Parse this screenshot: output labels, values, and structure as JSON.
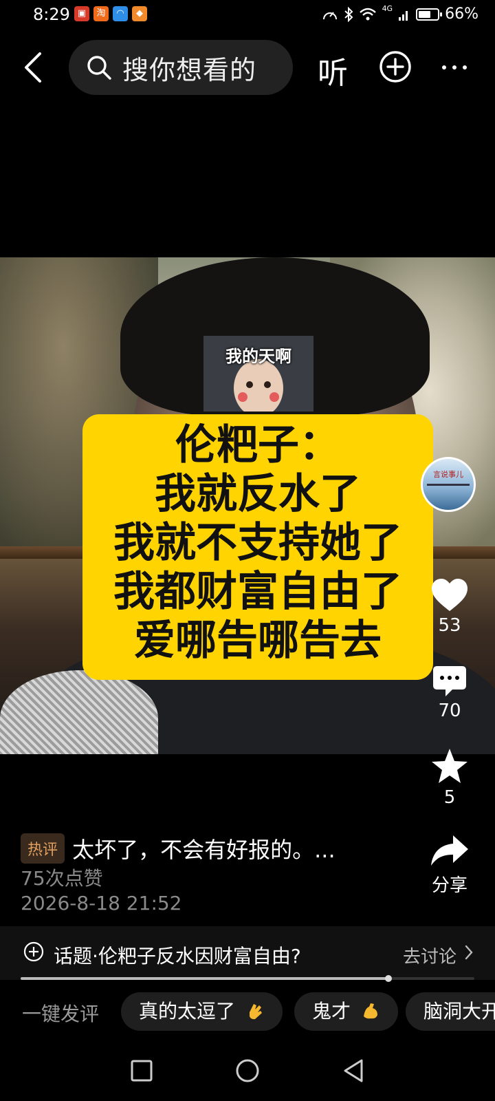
{
  "status_bar": {
    "time": "8:29",
    "network": "4G",
    "battery": "66%",
    "battery_level": 0.66,
    "notification_icons": [
      "app-icon-red",
      "taobao-icon",
      "app-icon-blue",
      "app-icon-orange"
    ]
  },
  "top_bar": {
    "search_placeholder": "搜你想看的",
    "listen_label": "听",
    "icons": [
      "back-arrow-icon",
      "search-icon",
      "plus-circle-icon",
      "more-dots-icon"
    ]
  },
  "video": {
    "sticker_text": "我的天啊",
    "caption_lines": [
      "伦粑子：",
      "我就反水了",
      "我就不支持她了",
      "我都财富自由了",
      "爱哪告哪告去"
    ],
    "author_avatar_text": "言说事儿",
    "caption_color": "#ffd400"
  },
  "actions": {
    "likes": "53",
    "comments": "70",
    "favorites": "5",
    "share_label": "分享"
  },
  "hot_comment": {
    "tag": "热评",
    "text": "太坏了，不会有好报的。...",
    "likes": "75次点赞",
    "date": "2026-8-18 21:52"
  },
  "topic": {
    "text": "话题·伦粑子反水因财富自由?",
    "link": "去讨论",
    "progress": 0.81
  },
  "quick_comment": {
    "label": "一键发评",
    "chips": [
      "真的太逗了",
      "鬼才",
      "脑洞大开"
    ]
  },
  "nav": {
    "icons": [
      "recent-apps-icon",
      "home-icon",
      "back-triangle-icon"
    ]
  }
}
